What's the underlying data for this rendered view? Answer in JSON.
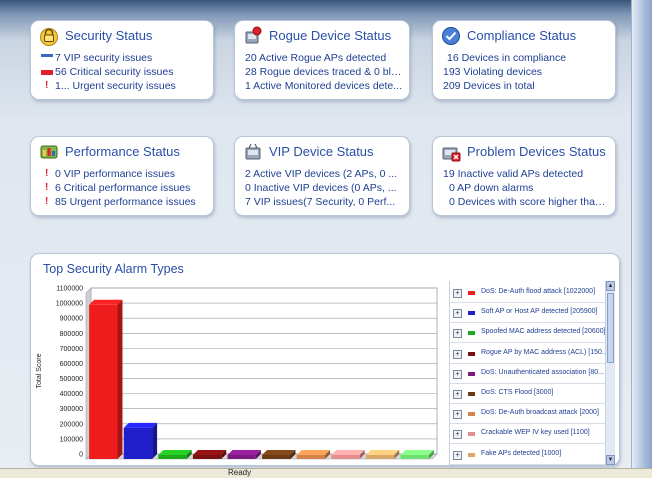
{
  "cards": {
    "security": {
      "title": "Security Status",
      "icon": "padlock-icon",
      "lines": [
        "7 VIP security issues",
        "56 Critical security issues",
        "1... Urgent security issues"
      ]
    },
    "rogue": {
      "title": "Rogue Device Status",
      "icon": "rogue-device-icon",
      "lines": [
        "20 Active Rogue APs detected",
        "28 Rogue devices traced & 0 blo...",
        "1 Active Monitored devices dete..."
      ]
    },
    "compliance": {
      "title": "Compliance Status",
      "icon": "check-shield-icon",
      "lines": [
        "16 Devices in compliance",
        "193 Violating devices",
        "209 Devices in total"
      ]
    },
    "performance": {
      "title": "Performance Status",
      "icon": "performance-icon",
      "lines": [
        "0 VIP performance issues",
        "6 Critical performance issues",
        "85 Urgent performance issues"
      ]
    },
    "vip": {
      "title": "VIP Device Status",
      "icon": "vip-device-icon",
      "lines": [
        "2 Active VIP devices (2 APs, 0 ...",
        "0 Inactive VIP devices (0 APs, ...",
        "7 VIP issues(7 Security, 0 Perf..."
      ]
    },
    "problem": {
      "title": "Problem Devices Status",
      "icon": "problem-device-icon",
      "lines": [
        "19 Inactive valid APs detected",
        "0 AP down alarms",
        "0 Devices with score higher than..."
      ]
    }
  },
  "colors": {
    "accent": "#2a4fa8",
    "critical": "#e0202a",
    "vip_bar": "#3a66c6"
  },
  "chart_title": "Top Security Alarm Types",
  "chart_data": {
    "type": "bar",
    "title": "",
    "ylabel": "Total Score",
    "xlabel": "",
    "ylim": [
      0,
      1100000
    ],
    "yticks": [
      0,
      100000,
      200000,
      300000,
      400000,
      500000,
      600000,
      700000,
      800000,
      900000,
      1000000,
      1100000
    ],
    "grid": true,
    "legend_position": "right",
    "categories": [
      "DoS: De-Auth flood attack [1022000]",
      "Soft AP or Host AP detected [205900]",
      "Spoofed MAC address detected [20600]",
      "Rogue AP by MAC address (ACL) [150...",
      "DoS: Unauthenticated association [80...",
      "DoS: CTS Flood [3000]",
      "DoS: De-Auth broadcast attack [2000]",
      "Crackable WEP IV key used [1100]",
      "Fake APs detected [1000]",
      ""
    ],
    "values": [
      1022000,
      205900,
      20600,
      15000,
      8000,
      3000,
      2000,
      1100,
      1000,
      800
    ],
    "colors": [
      "#ee1c1c",
      "#1f1fcc",
      "#1ea81e",
      "#7a1010",
      "#7c1a80",
      "#6b3a16",
      "#d4834a",
      "#e48e8e",
      "#d8a868",
      "#6fe06f"
    ]
  },
  "status_bar": "Ready"
}
